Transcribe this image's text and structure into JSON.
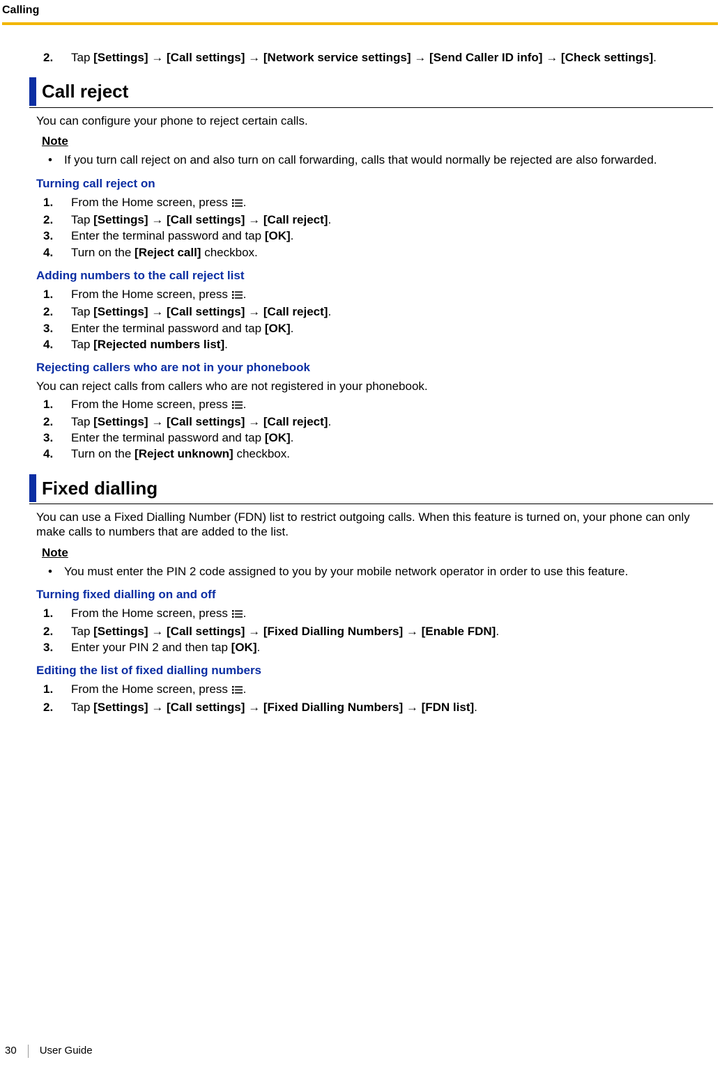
{
  "header": {
    "chapter": "Calling"
  },
  "footer": {
    "page": "30",
    "label": "User Guide"
  },
  "top_step": {
    "num": "2.",
    "parts": [
      "Tap ",
      {
        "b": "[Settings]"
      },
      " → ",
      {
        "b": "[Call settings]"
      },
      " → ",
      {
        "b": "[Network service settings]"
      },
      " → ",
      {
        "b": "[Send Caller ID info]"
      },
      " → ",
      {
        "b": "[Check settings]"
      },
      "."
    ]
  },
  "call_reject": {
    "heading": "Call reject",
    "intro": "You can configure your phone to reject certain calls.",
    "note_label": "Note",
    "note": "If you turn call reject on and also turn on call forwarding, calls that would normally be rejected are also forwarded.",
    "turn_on": {
      "heading": "Turning call reject on",
      "steps": [
        {
          "num": "1.",
          "parts": [
            "From the Home screen, press ",
            {
              "icon": true
            },
            "."
          ]
        },
        {
          "num": "2.",
          "parts": [
            "Tap ",
            {
              "b": "[Settings]"
            },
            " → ",
            {
              "b": "[Call settings]"
            },
            " → ",
            {
              "b": "[Call reject]"
            },
            "."
          ]
        },
        {
          "num": "3.",
          "parts": [
            "Enter the terminal password and tap ",
            {
              "b": "[OK]"
            },
            "."
          ]
        },
        {
          "num": "4.",
          "parts": [
            "Turn on the ",
            {
              "b": "[Reject call]"
            },
            " checkbox."
          ]
        }
      ]
    },
    "add_numbers": {
      "heading": "Adding numbers to the call reject list",
      "steps": [
        {
          "num": "1.",
          "parts": [
            "From the Home screen, press ",
            {
              "icon": true
            },
            "."
          ]
        },
        {
          "num": "2.",
          "parts": [
            "Tap ",
            {
              "b": "[Settings]"
            },
            " → ",
            {
              "b": "[Call settings]"
            },
            " → ",
            {
              "b": "[Call reject]"
            },
            "."
          ]
        },
        {
          "num": "3.",
          "parts": [
            "Enter the terminal password and tap ",
            {
              "b": "[OK]"
            },
            "."
          ]
        },
        {
          "num": "4.",
          "parts": [
            "Tap ",
            {
              "b": "[Rejected numbers list]"
            },
            "."
          ]
        }
      ]
    },
    "reject_unknown": {
      "heading": "Rejecting callers who are not in your phonebook",
      "intro": "You can reject calls from callers who are not registered in your phonebook.",
      "steps": [
        {
          "num": "1.",
          "parts": [
            "From the Home screen, press ",
            {
              "icon": true
            },
            "."
          ]
        },
        {
          "num": "2.",
          "parts": [
            "Tap ",
            {
              "b": "[Settings]"
            },
            " → ",
            {
              "b": "[Call settings]"
            },
            " → ",
            {
              "b": "[Call reject]"
            },
            "."
          ]
        },
        {
          "num": "3.",
          "parts": [
            "Enter the terminal password and tap ",
            {
              "b": "[OK]"
            },
            "."
          ]
        },
        {
          "num": "4.",
          "parts": [
            "Turn on the ",
            {
              "b": "[Reject unknown]"
            },
            " checkbox."
          ]
        }
      ]
    }
  },
  "fixed_dialling": {
    "heading": "Fixed dialling",
    "intro": "You can use a Fixed Dialling Number (FDN) list to restrict outgoing calls. When this feature is turned on, your phone can only make calls to numbers that are added to the list.",
    "note_label": "Note",
    "note": "You must enter the PIN 2 code assigned to you by your mobile network operator in order to use this feature.",
    "turn_on_off": {
      "heading": "Turning fixed dialling on and off",
      "steps": [
        {
          "num": "1.",
          "parts": [
            "From the Home screen, press ",
            {
              "icon": true
            },
            "."
          ]
        },
        {
          "num": "2.",
          "parts": [
            "Tap ",
            {
              "b": "[Settings]"
            },
            " → ",
            {
              "b": "[Call settings]"
            },
            " → ",
            {
              "b": "[Fixed Dialling Numbers]"
            },
            " → ",
            {
              "b": "[Enable FDN]"
            },
            "."
          ]
        },
        {
          "num": "3.",
          "parts": [
            "Enter your PIN 2 and then tap ",
            {
              "b": "[OK]"
            },
            "."
          ]
        }
      ]
    },
    "edit_list": {
      "heading": "Editing the list of fixed dialling numbers",
      "steps": [
        {
          "num": "1.",
          "parts": [
            "From the Home screen, press ",
            {
              "icon": true
            },
            "."
          ]
        },
        {
          "num": "2.",
          "parts": [
            "Tap ",
            {
              "b": "[Settings]"
            },
            " → ",
            {
              "b": "[Call settings]"
            },
            " → ",
            {
              "b": "[Fixed Dialling Numbers]"
            },
            " → ",
            {
              "b": "[FDN list]"
            },
            "."
          ]
        }
      ]
    }
  }
}
